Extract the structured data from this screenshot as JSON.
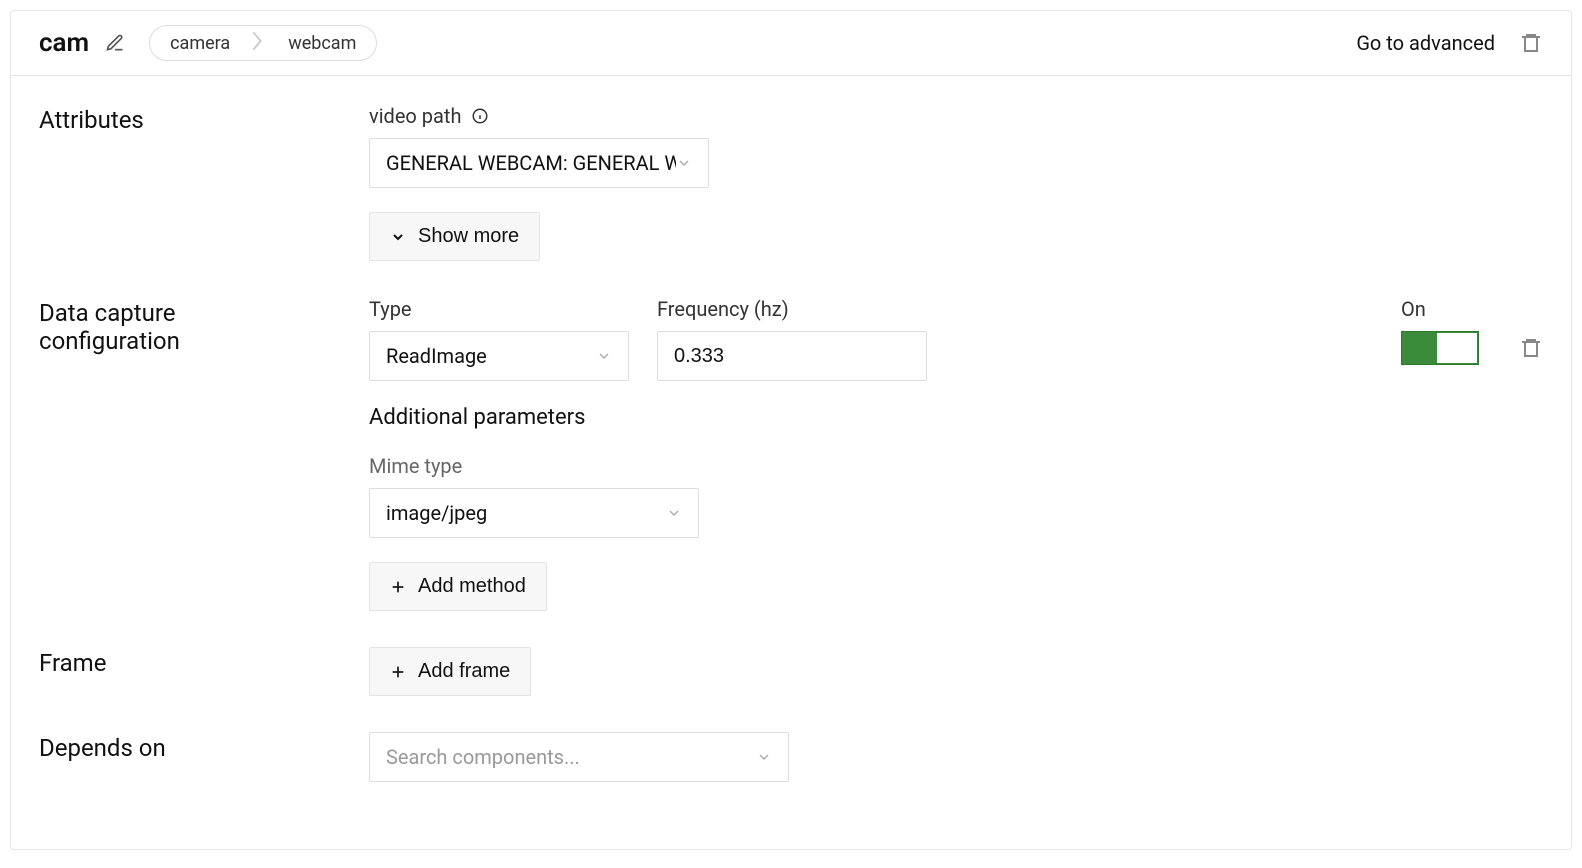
{
  "header": {
    "title": "cam",
    "breadcrumb": {
      "item1": "camera",
      "item2": "webcam"
    },
    "go_advanced": "Go to advanced"
  },
  "sections": {
    "attributes": {
      "label": "Attributes",
      "video_path_label": "video path",
      "video_path_value": "GENERAL WEBCAM: GENERAL W",
      "show_more": "Show more"
    },
    "data_capture": {
      "label": "Data capture configuration",
      "type_label": "Type",
      "type_value": "ReadImage",
      "freq_label": "Frequency (hz)",
      "freq_value": "0.333",
      "toggle_label": "On",
      "additional_label": "Additional parameters",
      "mime_label": "Mime type",
      "mime_value": "image/jpeg",
      "add_method": "Add method"
    },
    "frame": {
      "label": "Frame",
      "add_frame": "Add frame"
    },
    "depends_on": {
      "label": "Depends on",
      "placeholder": "Search components..."
    }
  }
}
